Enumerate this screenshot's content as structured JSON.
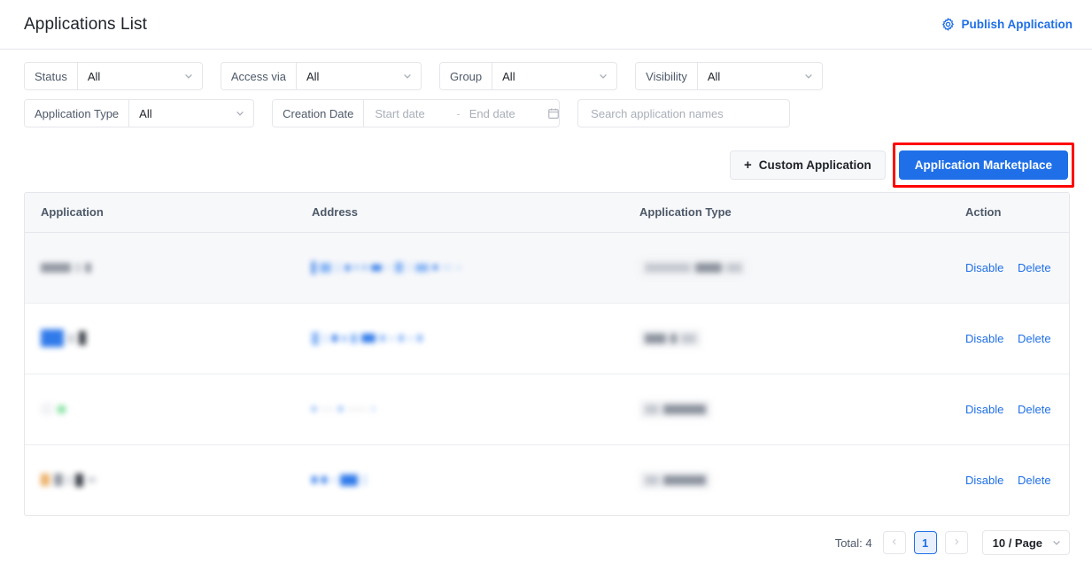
{
  "header": {
    "title": "Applications List",
    "publish_label": "Publish Application",
    "publish_icon": "gear-icon",
    "accent_color": "#1f6fe8"
  },
  "filters": {
    "row1": [
      {
        "label": "Status",
        "value": "All",
        "icon": "chevron-down-icon"
      },
      {
        "label": "Access via",
        "value": "All",
        "icon": "chevron-down-icon"
      },
      {
        "label": "Group",
        "value": "All",
        "icon": "chevron-down-icon"
      },
      {
        "label": "Visibility",
        "value": "All",
        "icon": "chevron-down-icon"
      }
    ],
    "app_type": {
      "label": "Application Type",
      "value": "All",
      "icon": "chevron-down-icon"
    },
    "creation_date": {
      "label": "Creation Date",
      "start_placeholder": "Start date",
      "separator": "-",
      "end_placeholder": "End date",
      "icon": "calendar-icon"
    },
    "search": {
      "placeholder": "Search application names",
      "value": "",
      "icon": "search-input"
    }
  },
  "toolbar": {
    "custom_application": {
      "label": "Custom Application",
      "icon": "plus-icon"
    },
    "marketplace": {
      "label": "Application Marketplace",
      "highlight_color": "#ff0000"
    }
  },
  "table": {
    "columns": [
      "Application",
      "Address",
      "Application Type",
      "Action"
    ],
    "rows": [
      {
        "application": "",
        "address": "",
        "app_type": "",
        "actions": [
          "Disable",
          "Delete"
        ],
        "hovered": true
      },
      {
        "application": "",
        "address": "",
        "app_type": "",
        "actions": [
          "Disable",
          "Delete"
        ],
        "hovered": false
      },
      {
        "application": "",
        "address": "",
        "app_type": "",
        "actions": [
          "Disable",
          "Delete"
        ],
        "hovered": false
      },
      {
        "application": "",
        "address": "",
        "app_type": "",
        "actions": [
          "Disable",
          "Delete"
        ],
        "hovered": false
      }
    ]
  },
  "pagination": {
    "total_label": "Total: 4",
    "prev_icon": "chevron-left-icon",
    "next_icon": "chevron-right-icon",
    "current_page": "1",
    "per_page_label": "10  / Page",
    "per_page_icon": "chevron-down-icon"
  }
}
